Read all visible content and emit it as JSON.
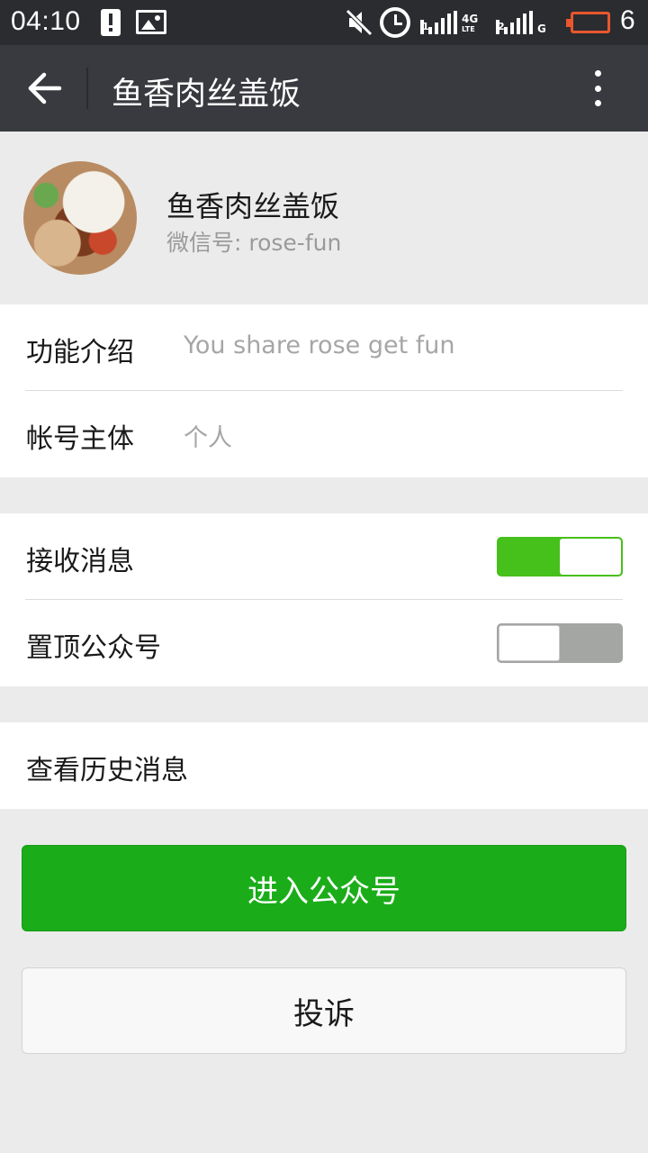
{
  "status_bar": {
    "time": "04:10",
    "signal1_label": "1",
    "signal1_network": "4G",
    "signal1_sub": "LTE",
    "signal2_label": "2",
    "signal2_network": "G",
    "battery_level": "6",
    "battery_color": "#e8572e",
    "icons": [
      "alert-icon",
      "image-icon",
      "mute-icon",
      "alarm-icon",
      "signal-icon",
      "battery-icon"
    ]
  },
  "header": {
    "title": "鱼香肉丝盖饭",
    "back_icon": "back-arrow-icon",
    "more_icon": "more-vertical-icon"
  },
  "profile": {
    "name": "鱼香肉丝盖饭",
    "wechat_id": "微信号: rose-fun"
  },
  "info": {
    "intro_label": "功能介绍",
    "intro_value": "You share rose get fun",
    "account_label": "帐号主体",
    "account_value": "个人"
  },
  "settings": {
    "receive_label": "接收消息",
    "receive_on": true,
    "pin_label": "置顶公众号",
    "pin_on": false
  },
  "history": {
    "label": "查看历史消息"
  },
  "buttons": {
    "enter_label": "进入公众号",
    "complain_label": "投诉"
  },
  "colors": {
    "accent": "#1aad19",
    "toggle_on": "#46c01b",
    "appbar": "#393a3f",
    "statusbar": "#2b2c2f"
  }
}
